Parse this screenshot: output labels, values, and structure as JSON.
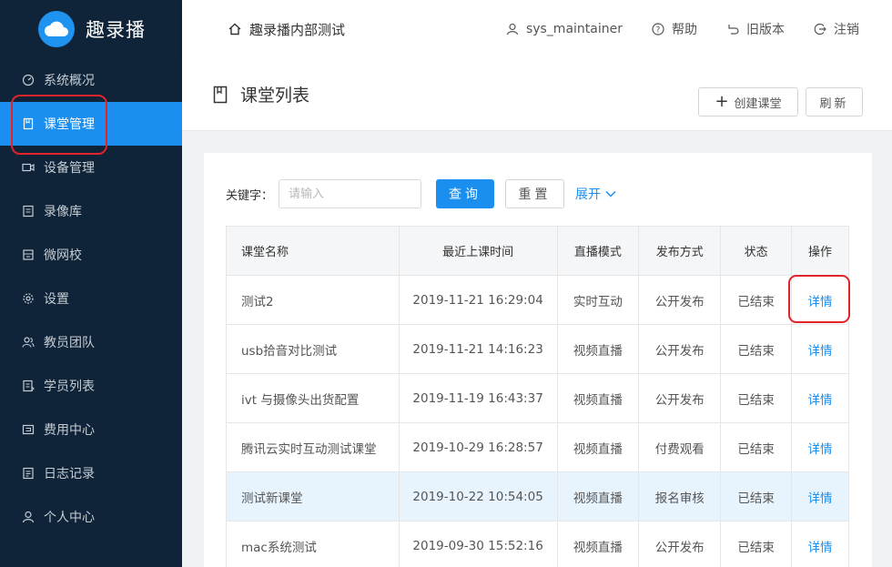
{
  "brand": {
    "name": "趣录播"
  },
  "sidebar": {
    "items": [
      {
        "label": "系统概况",
        "icon": "dashboard-icon"
      },
      {
        "label": "课堂管理",
        "icon": "book-icon",
        "active": true
      },
      {
        "label": "设备管理",
        "icon": "camera-icon"
      },
      {
        "label": "录像库",
        "icon": "folder-icon"
      },
      {
        "label": "微网校",
        "icon": "building-icon"
      },
      {
        "label": "设置",
        "icon": "gear-icon"
      },
      {
        "label": "教员团队",
        "icon": "team-icon"
      },
      {
        "label": "学员列表",
        "icon": "student-list-icon"
      },
      {
        "label": "费用中心",
        "icon": "wallet-icon"
      },
      {
        "label": "日志记录",
        "icon": "log-icon"
      },
      {
        "label": "个人中心",
        "icon": "user-icon"
      }
    ]
  },
  "topbar": {
    "breadcrumb": "趣录播内部测试",
    "user": "sys_maintainer",
    "help": "帮助",
    "old_version": "旧版本",
    "logout": "注销"
  },
  "page": {
    "title": "课堂列表",
    "create_label": "创建课堂",
    "refresh_label": "刷新"
  },
  "filter": {
    "keyword_label": "关键字：",
    "placeholder": "请输入",
    "value": "",
    "query_label": "查询",
    "reset_label": "重置",
    "expand_label": "展开"
  },
  "table": {
    "headers": [
      "课堂名称",
      "最近上课时间",
      "直播模式",
      "发布方式",
      "状态",
      "操作"
    ],
    "rows": [
      {
        "name": "测试2",
        "time": "2019-11-21 16:29:04",
        "mode": "实时互动",
        "publish": "公开发布",
        "status": "已结束",
        "action": "详情"
      },
      {
        "name": "usb拾音对比测试",
        "time": "2019-11-21 14:16:23",
        "mode": "视频直播",
        "publish": "公开发布",
        "status": "已结束",
        "action": "详情"
      },
      {
        "name": "ivt 与摄像头出货配置",
        "time": "2019-11-19 16:43:37",
        "mode": "视频直播",
        "publish": "公开发布",
        "status": "已结束",
        "action": "详情"
      },
      {
        "name": "腾讯云实时互动测试课堂",
        "time": "2019-10-29 16:28:57",
        "mode": "视频直播",
        "publish": "付费观看",
        "status": "已结束",
        "action": "详情"
      },
      {
        "name": "测试新课堂",
        "time": "2019-10-22 10:54:05",
        "mode": "视频直播",
        "publish": "报名审核",
        "status": "已结束",
        "action": "详情"
      },
      {
        "name": "mac系统测试",
        "time": "2019-09-30 15:52:16",
        "mode": "视频直播",
        "publish": "公开发布",
        "status": "已结束",
        "action": "详情"
      }
    ]
  },
  "colors": {
    "sidebar_bg": "#0f2438",
    "accent": "#1b8ff0",
    "highlight_row": "#e8f4fd",
    "annotation": "#e0242a"
  }
}
